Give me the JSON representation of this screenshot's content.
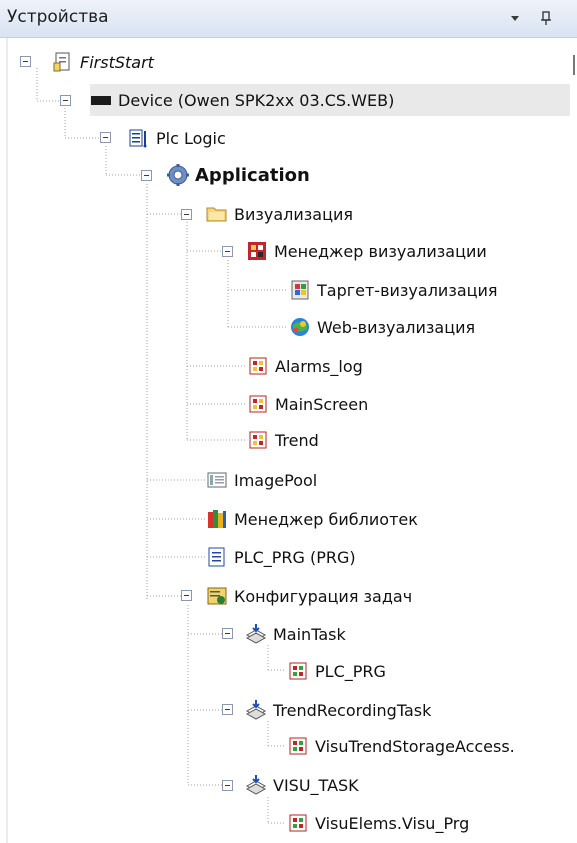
{
  "panel": {
    "title": "Устройства",
    "dropdown_glyph": "▾",
    "pin_glyph": "ㅁ"
  },
  "tree": {
    "items": [
      {
        "label": "FirstStart",
        "icon": "project-icon"
      },
      {
        "label": "Device (Owen SPK2xx 03.CS.WEB)",
        "icon": "device-icon"
      },
      {
        "label": "Plc Logic",
        "icon": "plc-logic-icon"
      },
      {
        "label": "Application",
        "icon": "gear-icon"
      },
      {
        "label": "Визуализация",
        "icon": "folder-icon"
      },
      {
        "label": "Менеджер визуализации",
        "icon": "visu-manager-icon"
      },
      {
        "label": "Таргет-визуализация",
        "icon": "target-visu-icon"
      },
      {
        "label": "Web-визуализация",
        "icon": "web-visu-icon"
      },
      {
        "label": "Alarms_log",
        "icon": "visualization-icon"
      },
      {
        "label": "MainScreen",
        "icon": "visualization-icon"
      },
      {
        "label": "Trend",
        "icon": "visualization-icon"
      },
      {
        "label": "ImagePool",
        "icon": "image-pool-icon"
      },
      {
        "label": "Менеджер библиотек",
        "icon": "library-manager-icon"
      },
      {
        "label": "PLC_PRG (PRG)",
        "icon": "program-icon"
      },
      {
        "label": "Конфигурация задач",
        "icon": "task-config-icon"
      },
      {
        "label": "MainTask",
        "icon": "task-icon"
      },
      {
        "label": "PLC_PRG",
        "icon": "program-call-icon"
      },
      {
        "label": "TrendRecordingTask",
        "icon": "task-icon"
      },
      {
        "label": "VisuTrendStorageAccess.",
        "icon": "program-call-icon"
      },
      {
        "label": "VISU_TASK",
        "icon": "task-icon"
      },
      {
        "label": "VisuElems.Visu_Prg",
        "icon": "program-call-icon"
      }
    ]
  }
}
